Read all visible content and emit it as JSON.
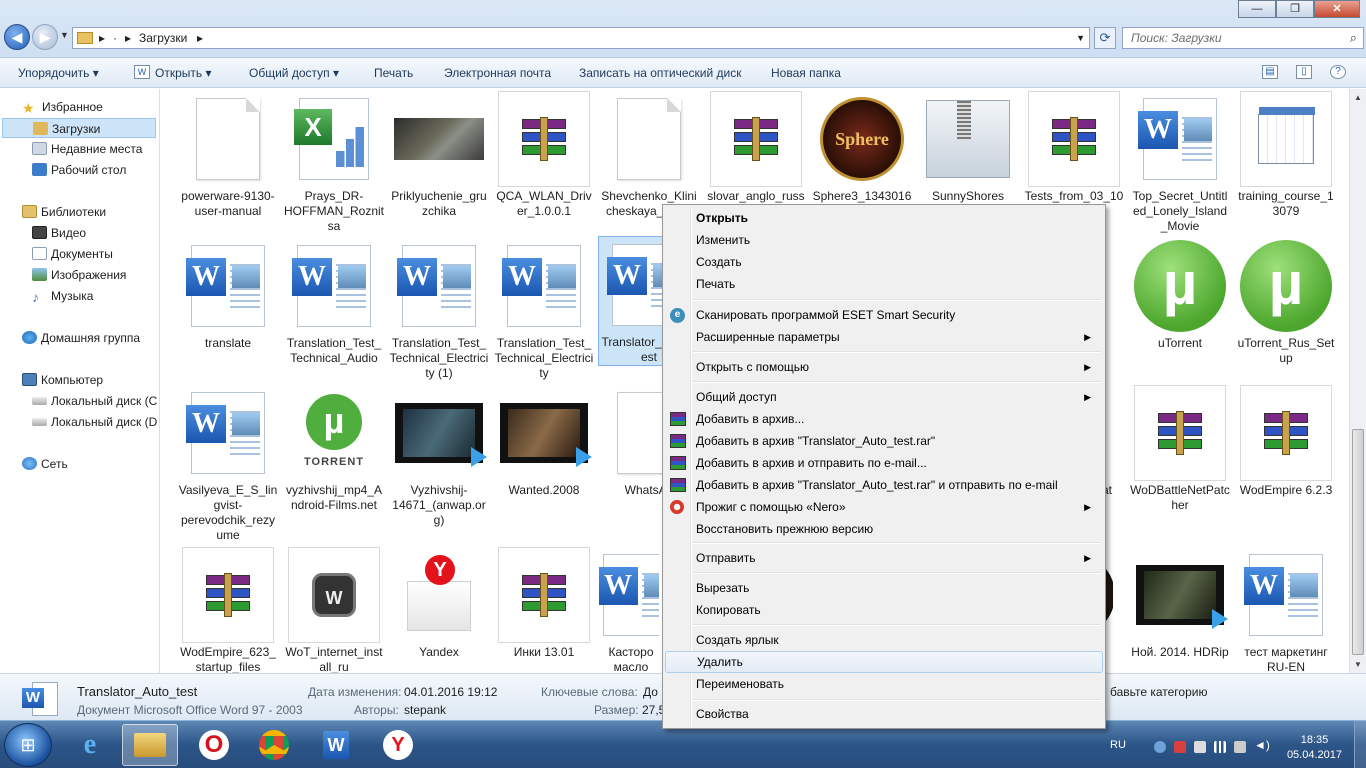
{
  "address": {
    "segments": [
      "▸",
      "·",
      "▸",
      "Загрузки",
      "▸"
    ],
    "search_placeholder": "Поиск: Загрузки"
  },
  "toolbar": {
    "organize": "Упорядочить ▾",
    "open": "Открыть ▾",
    "share": "Общий доступ ▾",
    "print": "Печать",
    "email": "Электронная почта",
    "burn": "Записать на оптический диск",
    "new_folder": "Новая папка"
  },
  "nav": {
    "favorites": "Избранное",
    "downloads": "Загрузки",
    "recent": "Недавние места",
    "desktop": "Рабочий стол",
    "libraries": "Библиотеки",
    "video": "Видео",
    "documents": "Документы",
    "images": "Изображения",
    "music": "Музыка",
    "homegroup": "Домашняя группа",
    "computer": "Компьютер",
    "disk_c": "Локальный диск (C",
    "disk_d": "Локальный диск (D",
    "network": "Сеть"
  },
  "files": [
    {
      "label": "powerware-9130-user-manual",
      "icon": "blank-doc-icon"
    },
    {
      "label": "Prays_DR-HOFFMAN_Roznitsa",
      "icon": "excel-icon"
    },
    {
      "label": "Priklyuchenie_gruzchika",
      "icon": "photo-thumbnail"
    },
    {
      "label": "QCA_WLAN_Driver_1.0.0.1",
      "icon": "winrar-icon"
    },
    {
      "label": "Shevchenko_Klinicheskaya_gia.dj",
      "icon": "blank-doc-icon"
    },
    {
      "label": "slovar_anglo_russ",
      "icon": "winrar-icon"
    },
    {
      "label": "Sphere3_1343016",
      "icon": "sphere-logo-icon"
    },
    {
      "label": "SunnyShores",
      "icon": "zip-folder-icon"
    },
    {
      "label": "Tests_from_03_10",
      "icon": "winrar-icon"
    },
    {
      "label": "Top_Secret_Untitled_Lonely_Island_Movie",
      "icon": "word-icon"
    },
    {
      "label": "training_course_13079",
      "icon": "calendar-icon"
    },
    {
      "label": "translate",
      "icon": "word-icon"
    },
    {
      "label": "Translation_Test_Technical_Audio",
      "icon": "word-icon"
    },
    {
      "label": "Translation_Test_Technical_Electricity (1)",
      "icon": "word-icon"
    },
    {
      "label": "Translation_Test_Technical_Electricity",
      "icon": "word-icon"
    },
    {
      "label": "Translator_Auto_test",
      "icon": "word-icon"
    },
    {
      "label": "uTorrent",
      "icon": "utorrent-icon"
    },
    {
      "label": "uTorrent_Rus_Setup",
      "icon": "utorrent-icon"
    },
    {
      "label": "Vasilyeva_E_S_lingvist-perevodchik_rezyume",
      "icon": "word-icon"
    },
    {
      "label": "vyzhivshij_mp4_Android-Films.net",
      "icon": "torrent-file-icon"
    },
    {
      "label": "Vyzhivshij-14671_(anwap.org)",
      "icon": "video-icon"
    },
    {
      "label": "Wanted.2008",
      "icon": "video-icon"
    },
    {
      "label": "WhatsAp",
      "icon": "blank-doc-icon"
    },
    {
      "label": "WoDBattleNetPatcher",
      "icon": "winrar-icon"
    },
    {
      "label": "WodEmpire 6.2.3",
      "icon": "winrar-icon"
    },
    {
      "label": "WodEmpire_623_startup_files",
      "icon": "winrar-icon"
    },
    {
      "label": "WoT_internet_install_ru",
      "icon": "wot-icon"
    },
    {
      "label": "Yandex",
      "icon": "yandex-icon"
    },
    {
      "label": "Инки 13.01",
      "icon": "winrar-icon"
    },
    {
      "label": "Касторо масло",
      "icon": "word-icon"
    },
    {
      "label": "Ной. 2014. HDRip",
      "icon": "video-icon"
    },
    {
      "label": "тест маркетинг RU-EN",
      "icon": "word-icon"
    }
  ],
  "partial_labels": {
    "r2": "C",
    "r3": "Pat"
  },
  "details": {
    "name": "Translator_Auto_test",
    "type": "Документ Microsoft Office Word 97 - 2003",
    "date_key": "Дата изменения:",
    "date_val": "04.01.2016 19:12",
    "authors_key": "Авторы:",
    "authors_val": "stepank",
    "keywords_key": "Ключевые слова:",
    "keywords_val": "До",
    "size_key": "Размер:",
    "size_val": "27,5",
    "category_hint": "бавьте категорию"
  },
  "context_menu": {
    "open": "Открыть",
    "edit": "Изменить",
    "new": "Создать",
    "print": "Печать",
    "eset": "Сканировать программой ESET Smart Security",
    "advanced": "Расширенные параметры",
    "open_with": "Открыть с помощью",
    "share": "Общий доступ",
    "add_archive": "Добавить в архив...",
    "add_rar": "Добавить в архив \"Translator_Auto_test.rar\"",
    "add_email": "Добавить в архив и отправить по e-mail...",
    "add_rar_email": "Добавить в архив \"Translator_Auto_test.rar\" и отправить по e-mail",
    "nero": "Прожиг с помощью «Nero»",
    "restore": "Восстановить прежнюю версию",
    "send_to": "Отправить",
    "cut": "Вырезать",
    "copy": "Копировать",
    "shortcut": "Создать ярлык",
    "delete": "Удалить",
    "rename": "Переименовать",
    "properties": "Свойства"
  },
  "taskbar": {
    "lang": "RU",
    "time": "18:35",
    "date": "05.04.2017"
  }
}
